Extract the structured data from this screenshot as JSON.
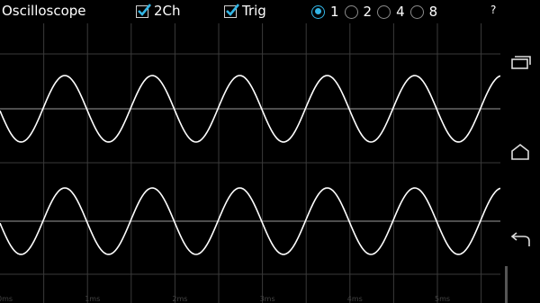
{
  "app": {
    "title": "Oscilloscope",
    "two_channel": {
      "label": "2Ch",
      "checked": true
    },
    "trigger": {
      "label": "Trig",
      "checked": true
    },
    "sweep_options": [
      {
        "label": "1",
        "selected": true
      },
      {
        "label": "2",
        "selected": false
      },
      {
        "label": "4",
        "selected": false
      },
      {
        "label": "8",
        "selected": false
      }
    ],
    "help_label": "?"
  },
  "scope": {
    "time_ticks": [
      "0ms",
      "1ms",
      "2ms",
      "3ms",
      "4ms",
      "5ms"
    ],
    "channels": [
      {
        "name": "channel-1",
        "cycles_visible": 5.7
      },
      {
        "name": "channel-2",
        "cycles_visible": 5.7
      }
    ],
    "colors": {
      "trace": "#ffffff",
      "grid": "#3a3a3a",
      "baseline": "#9a9a9a",
      "accent": "#33b5e5"
    }
  },
  "navbar": {
    "icons": [
      "recent-apps-icon",
      "home-icon",
      "back-icon"
    ]
  }
}
